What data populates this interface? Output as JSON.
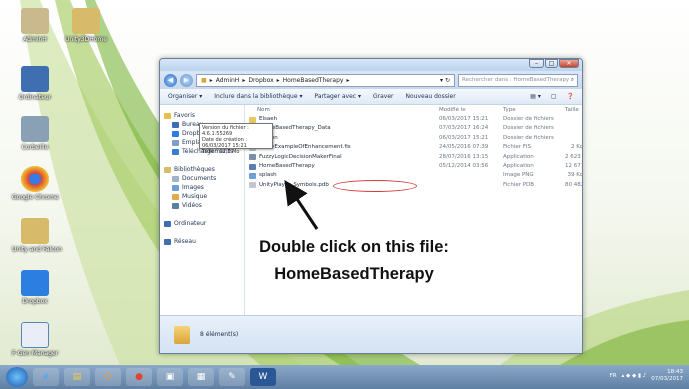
{
  "desktop": {
    "icons": [
      {
        "label": "AdminH",
        "icon": "user-folder-icon",
        "color": "#c9b98c"
      },
      {
        "label": "Ordinateur",
        "icon": "computer-icon",
        "color": "#3f6fb0"
      },
      {
        "label": "Corbeille",
        "icon": "recycle-bin-icon",
        "color": "#8aa1b5"
      },
      {
        "label": "Google Chrome",
        "icon": "chrome-icon",
        "color": "#e0432f"
      },
      {
        "label": "Unity and Falcon",
        "icon": "folder-icon",
        "color": "#d8bb6a"
      },
      {
        "label": "Dropbox",
        "icon": "dropbox-icon",
        "color": "#2c7fe0"
      },
      {
        "label": "F-Gen Manager",
        "icon": "f-gen-icon",
        "color": "#5b84b8"
      }
    ],
    "extra_icon": {
      "label": "Unity3DHome",
      "icon": "folder-icon"
    }
  },
  "explorer": {
    "window_controls": [
      "–",
      "□",
      "✕"
    ],
    "breadcrumb": [
      "AdminH",
      "Dropbox",
      "HomeBasedTherapy"
    ],
    "search_placeholder": "Rechercher dans : HomeBasedTherapy",
    "toolbar": {
      "organize": "Organiser ▾",
      "include": "Inclure dans la bibliothèque ▾",
      "share": "Partager avec ▾",
      "burn": "Graver",
      "new_folder": "Nouveau dossier"
    },
    "nav": [
      {
        "label": "Favoris",
        "color": "#e8c14a"
      },
      {
        "label": "Bureau",
        "color": "#3b6fb3"
      },
      {
        "label": "Dropbox",
        "color": "#2c7fe0"
      },
      {
        "label": "Emplacements récer",
        "color": "#7ea0c8"
      },
      {
        "label": "Téléchargements",
        "color": "#3a7bd5"
      },
      {
        "label": "",
        "color": "transparent"
      },
      {
        "label": "Bibliothèques",
        "color": "#d8bb6a"
      },
      {
        "label": "Documents",
        "color": "#9fb3c8"
      },
      {
        "label": "Images",
        "color": "#6a9fd8"
      },
      {
        "label": "Musique",
        "color": "#e2a84a"
      },
      {
        "label": "Vidéos",
        "color": "#5c7ea8"
      },
      {
        "label": "",
        "color": "transparent"
      },
      {
        "label": "Ordinateur",
        "color": "#3f6fb0"
      },
      {
        "label": "",
        "color": "transparent"
      },
      {
        "label": "Réseau",
        "color": "#3f6fb0"
      }
    ],
    "columns": [
      "Nom",
      "Modifié le",
      "Type",
      "Taille"
    ],
    "files": [
      {
        "name": "Elsaeh",
        "date": "06/03/2017 15:21",
        "type": "Dossier de fichiers",
        "size": "",
        "color": "#e8c860"
      },
      {
        "name": "HomeBasedTherapy_Data",
        "date": "07/03/2017 16:24",
        "type": "Dossier de fichiers",
        "size": "",
        "color": "#e8c860"
      },
      {
        "name": "Marion",
        "date": "06/03/2017 15:21",
        "type": "Dossier de fichiers",
        "size": "",
        "color": "#e8c860"
      },
      {
        "name": "FuzzyExampleOfEnhancement.fis",
        "date": "24/05/2016 07:39",
        "type": "Fichier FIS",
        "size": "2 Ko",
        "color": "#c0c7d2"
      },
      {
        "name": "FuzzyLogicDecisionMakerFinal",
        "date": "28/07/2016 13:15",
        "type": "Application",
        "size": "2 623 Ko",
        "color": "#7c8fa8"
      },
      {
        "name": "HomeBasedTherapy",
        "date": "05/12/2014 03:56",
        "type": "Application",
        "size": "12 677 Ko",
        "color": "#5a7fae"
      },
      {
        "name": "splash",
        "date": "",
        "type": "Image PNG",
        "size": "39 Ko",
        "color": "#6da0d4"
      },
      {
        "name": "UnityPlayer_Symbols.pdb",
        "date": "",
        "type": "Fichier PDB",
        "size": "80 482 Ko",
        "color": "#c0c7d2"
      }
    ],
    "tooltip": [
      "Version du fichier : 4.6.1.55269",
      "Date de création : 06/03/2017 15:21",
      "Taille : 12,3 Mo"
    ],
    "status": "8 élément(s)"
  },
  "annotation": {
    "line1": "Double click on this file:",
    "line2": "HomeBasedTherapy"
  },
  "taskbar": {
    "apps": [
      "folder-icon",
      "ie-icon",
      "explorer-icon",
      "outlook-icon",
      "chrome-icon",
      "app-icon",
      "app-icon",
      "paint-icon",
      "word-icon"
    ],
    "tray_text": "FR",
    "time": "18:43",
    "date": "07/03/2017"
  }
}
